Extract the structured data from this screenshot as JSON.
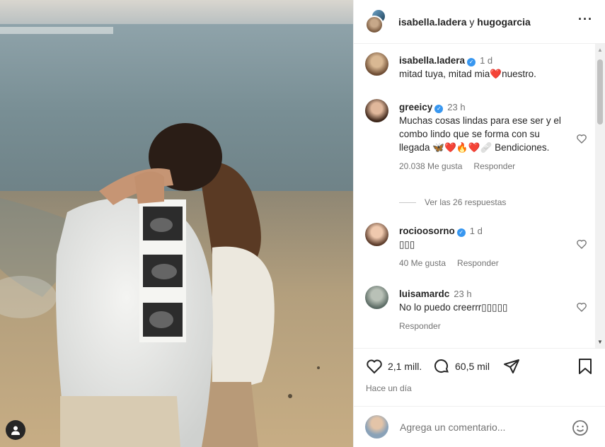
{
  "header": {
    "user_a": "isabella.ladera",
    "conj": " y ",
    "user_b": "hugogarcia"
  },
  "caption": {
    "username": "isabella.ladera",
    "time": "1 d",
    "text": "mitad tuya, mitad mia❤️nuestro."
  },
  "comments": [
    {
      "username": "greeicy",
      "verified": true,
      "time": "23 h",
      "text": "Muchas cosas lindas para ese ser y el combo lindo que se forma con su llegada 🦋❤️🔥❤️🩹 Bendiciones.",
      "likes": "20.038 Me gusta",
      "reply": "Responder"
    },
    {
      "username": "rocioosorno",
      "verified": true,
      "time": "1 d",
      "text": "▯▯▯",
      "likes": "40 Me gusta",
      "reply": "Responder"
    },
    {
      "username": "luisamardc",
      "verified": false,
      "time": "23 h",
      "text": "No lo puedo creerrr▯▯▯▯▯",
      "likes": "",
      "reply": "Responder"
    }
  ],
  "view_replies": "Ver las 26 respuestas",
  "actions": {
    "likes_count": "2,1 mill.",
    "comments_count": "60,5 mil",
    "posted": "Hace un día"
  },
  "add_comment": {
    "placeholder": "Agrega un comentario..."
  },
  "icons": {
    "more": "more-horizontal-icon",
    "verified": "verified-badge-icon",
    "heart": "heart-icon",
    "comment": "comment-bubble-icon",
    "share": "paper-plane-icon",
    "save": "bookmark-icon",
    "emoji": "emoji-smile-icon",
    "tag": "user-tag-icon"
  },
  "colors": {
    "verified": "#3897f0",
    "text": "#262626",
    "muted": "#737373"
  }
}
